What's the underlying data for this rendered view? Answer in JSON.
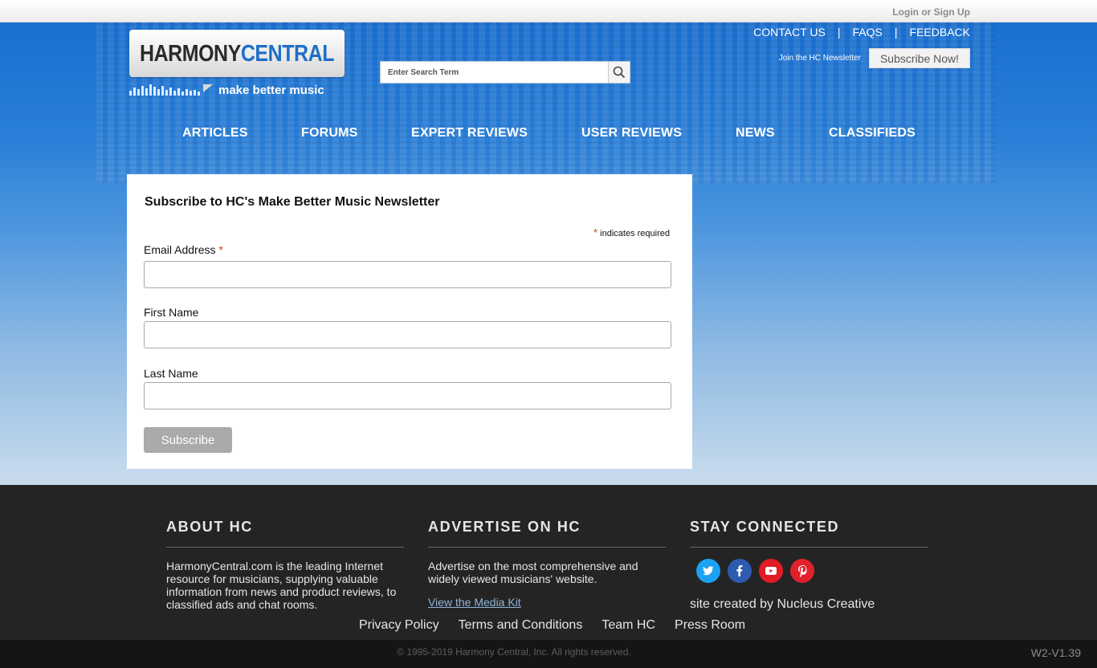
{
  "header": {
    "login_label": "Login",
    "or_label": "or",
    "signup_label": "Sign Up",
    "logo_part1": "HARMONY",
    "logo_part2": "CENTRAL",
    "tagline": "make better music",
    "search_placeholder": "Enter Search Term",
    "top_links": [
      "CONTACT US",
      "FAQS",
      "FEEDBACK"
    ],
    "top_link_separator": "|",
    "newsletter_label": "Join the HC Newsletter",
    "newsletter_button": "Subscribe Now!"
  },
  "nav": [
    "ARTICLES",
    "FORUMS",
    "EXPERT REVIEWS",
    "USER REVIEWS",
    "NEWS",
    "CLASSIFIEDS"
  ],
  "form": {
    "title": "Subscribe to HC's Make Better Music Newsletter",
    "required_marker": "*",
    "required_note": "indicates required",
    "email_label": "Email Address",
    "first_name_label": "First Name",
    "last_name_label": "Last Name",
    "email_value": "",
    "first_name_value": "",
    "last_name_value": "",
    "submit_label": "Subscribe"
  },
  "footer": {
    "about_title": "ABOUT HC",
    "about_text": "HarmonyCentral.com is the leading Internet resource for musicians, supplying valuable information from news and product reviews, to classified ads and chat rooms.",
    "advertise_title": "ADVERTISE ON HC",
    "advertise_text": "Advertise on the most comprehensive and widely viewed musicians' website.",
    "media_kit_link": "View the Media Kit",
    "connected_title": "STAY CONNECTED",
    "credit": "site created by Nucleus Creative",
    "links": [
      "Privacy Policy",
      "Terms and Conditions",
      "Team HC",
      "Press Room"
    ],
    "copyright": "© 1995-2019 Harmony Central, Inc. All rights reserved.",
    "version": "W2-V1.39"
  },
  "social": [
    {
      "name": "twitter-icon",
      "color": "#1da1f2"
    },
    {
      "name": "facebook-icon",
      "color": "#2d5bb0"
    },
    {
      "name": "youtube-icon",
      "color": "#e31b23"
    },
    {
      "name": "pinterest-icon",
      "color": "#e0202c"
    }
  ]
}
